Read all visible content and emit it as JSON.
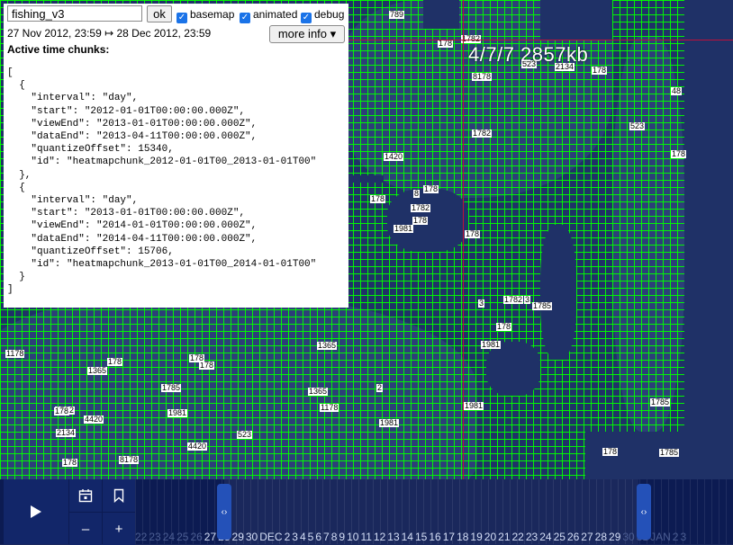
{
  "debug_panel": {
    "layer_value": "fishing_v3",
    "ok_label": "ok",
    "checkboxes": [
      {
        "label": "basemap",
        "checked": true
      },
      {
        "label": "animated",
        "checked": true
      },
      {
        "label": "debug",
        "checked": true
      }
    ],
    "time_range": "27 Nov 2012, 23:59 ↦ 28 Dec 2012, 23:59",
    "more_info_label": "more info ▾",
    "chunks_title": "Active time chunks:",
    "chunks_json": "[\n  {\n    \"interval\": \"day\",\n    \"start\": \"2012-01-01T00:00:00.000Z\",\n    \"viewEnd\": \"2013-01-01T00:00:00.000Z\",\n    \"dataEnd\": \"2013-04-11T00:00:00.000Z\",\n    \"quantizeOffset\": 15340,\n    \"id\": \"heatmapchunk_2012-01-01T00_2013-01-01T00\"\n  },\n  {\n    \"interval\": \"day\",\n    \"start\": \"2013-01-01T00:00:00.000Z\",\n    \"viewEnd\": \"2014-01-01T00:00:00.000Z\",\n    \"dataEnd\": \"2014-04-11T00:00:00.000Z\",\n    \"quantizeOffset\": 15706,\n    \"id\": \"heatmapchunk_2013-01-01T00_2014-01-01T00\"\n  }\n]"
  },
  "map": {
    "tile_size_label": "4/7/7 2857kb",
    "tile_labels": [
      "1782",
      "8",
      "178",
      "1782",
      "8178",
      "1981",
      "1785",
      "48",
      "1782",
      "8178",
      "1420",
      "178",
      "2134",
      "1981",
      "178",
      "1785",
      "3",
      "178",
      "1365",
      "523",
      "178",
      "178",
      "1785",
      "3",
      "789",
      "1981",
      "4420",
      "1782",
      "178",
      "1178",
      "178",
      "1365",
      "523",
      "178",
      "1981",
      "1785",
      "2",
      "178",
      "2134",
      "178",
      "1178",
      "1365",
      "523",
      "1782",
      "178",
      "1981",
      "178",
      "4420",
      "178"
    ],
    "accent": "#00ff00",
    "crosshair": "#c0103a"
  },
  "timebar": {
    "play_icon": "play-icon",
    "days": [
      "22",
      "23",
      "24",
      "25",
      "26",
      "27",
      "28",
      "29",
      "30",
      "DEC",
      "2",
      "3",
      "4",
      "5",
      "6",
      "7",
      "8",
      "9",
      "10",
      "11",
      "12",
      "13",
      "14",
      "15",
      "16",
      "17",
      "18",
      "19",
      "20",
      "21",
      "22",
      "23",
      "24",
      "25",
      "26",
      "27",
      "28",
      "29",
      "30",
      "31",
      "JAN",
      "2",
      "3"
    ],
    "in_range_from": 5,
    "in_range_to": 37
  }
}
